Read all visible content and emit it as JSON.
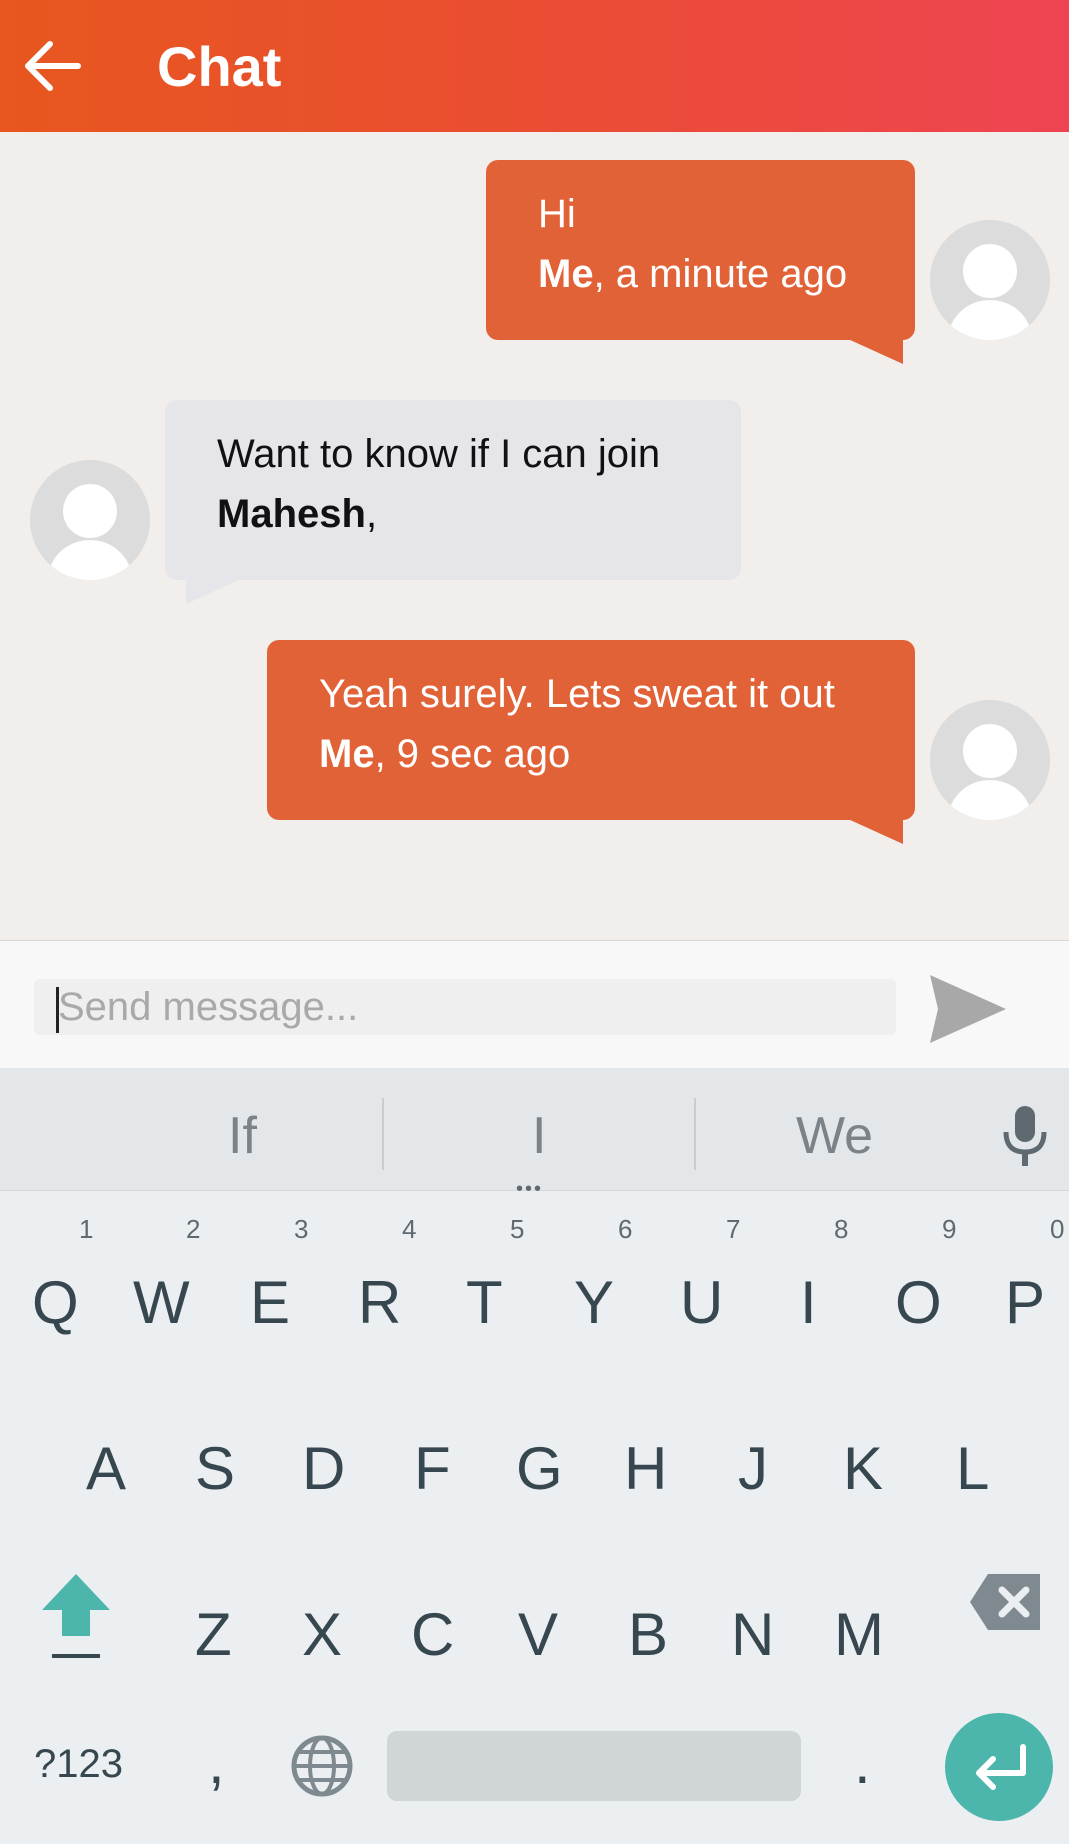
{
  "appbar": {
    "title": "Chat"
  },
  "messages": [
    {
      "sender": "me",
      "text": "Hi",
      "author": "Me",
      "meta": ", a minute ago"
    },
    {
      "sender": "them",
      "text": "Want to know if I can join",
      "author": "Mahesh",
      "meta": ","
    },
    {
      "sender": "me",
      "text": "Yeah surely. Lets sweat it out",
      "author": "Me",
      "meta": ", 9 sec ago"
    }
  ],
  "composer": {
    "placeholder": "Send message...",
    "value": ""
  },
  "keyboard": {
    "suggestions": [
      "If",
      "I",
      "We"
    ],
    "row1": [
      "Q",
      "W",
      "E",
      "R",
      "T",
      "Y",
      "U",
      "I",
      "O",
      "P"
    ],
    "row1_hints": [
      "1",
      "2",
      "3",
      "4",
      "5",
      "6",
      "7",
      "8",
      "9",
      "0"
    ],
    "row2": [
      "A",
      "S",
      "D",
      "F",
      "G",
      "H",
      "J",
      "K",
      "L"
    ],
    "row3": [
      "Z",
      "X",
      "C",
      "V",
      "B",
      "N",
      "M"
    ],
    "symbols_label": "?123",
    "comma_label": ",",
    "period_label": "."
  },
  "colors": {
    "appbar_start": "#e8571f",
    "appbar_end": "#ee4452",
    "my_bubble": "#e26237",
    "their_bubble": "#e6e5ea",
    "enter_key": "#4db6ac"
  }
}
